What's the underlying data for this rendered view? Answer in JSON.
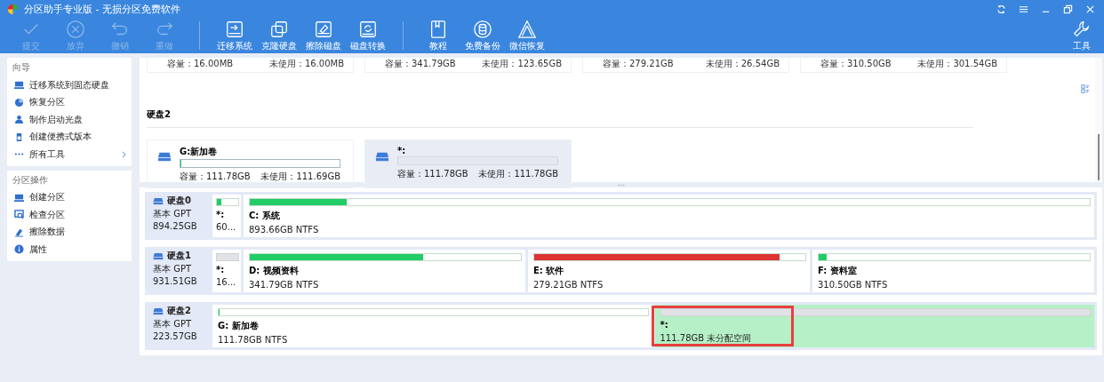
{
  "window": {
    "title": "分区助手专业版 - 无损分区免费软件"
  },
  "toolbar": [
    {
      "label": "提交",
      "disabled": true
    },
    {
      "label": "放弃",
      "disabled": true
    },
    {
      "label": "撤销",
      "disabled": true
    },
    {
      "label": "重做",
      "disabled": true
    },
    {
      "label": "迁移系统",
      "disabled": false
    },
    {
      "label": "克隆硬盘",
      "disabled": false
    },
    {
      "label": "擦除磁盘",
      "disabled": false
    },
    {
      "label": "磁盘转换",
      "disabled": false
    },
    {
      "label": "教程",
      "disabled": false
    },
    {
      "label": "免费备份",
      "disabled": false
    },
    {
      "label": "微信恢复",
      "disabled": false
    }
  ],
  "tools_button": {
    "label": "工具"
  },
  "sidebar": [
    {
      "title": "向导",
      "items": [
        {
          "label": "迁移系统到固态硬盘",
          "more": false
        },
        {
          "label": "恢复分区",
          "more": false
        },
        {
          "label": "制作启动光盘",
          "more": false
        },
        {
          "label": "创建便携式版本",
          "more": false
        },
        {
          "label": "所有工具",
          "more": true
        }
      ]
    },
    {
      "title": "分区操作",
      "items": [
        {
          "label": "创建分区",
          "more": false
        },
        {
          "label": "检查分区",
          "more": false
        },
        {
          "label": "擦除数据",
          "more": false
        },
        {
          "label": "属性",
          "more": false
        }
      ]
    }
  ],
  "cards_above": [
    {
      "capacity": "容量：16.00MB",
      "unused": "未使用：16.00MB"
    },
    {
      "capacity": "容量：341.79GB",
      "unused": "未使用：123.65GB"
    },
    {
      "capacity": "容量：279.21GB",
      "unused": "未使用：26.54GB"
    },
    {
      "capacity": "容量：310.50GB",
      "unused": "未使用：301.54GB"
    }
  ],
  "card_section": {
    "title": "硬盘2",
    "cards": [
      {
        "name": "G:新加卷",
        "kind": "volume",
        "level": 0.001,
        "capacity": "容量：111.78GB",
        "unused": "未使用：111.69GB",
        "selected": false
      },
      {
        "name": "*:",
        "kind": "unallocated",
        "capacity": "容量：111.78GB",
        "unused": "未使用：111.78GB",
        "selected": true
      }
    ]
  },
  "disks": [
    {
      "name": "硬盘0",
      "type": "基本 GPT",
      "size": "894.25GB",
      "partitions": [
        {
          "kind": "small",
          "name": "*:",
          "detail": "60...",
          "level": 0.2,
          "color": "#22cc66",
          "selected": false,
          "highlighted": false
        },
        {
          "kind": "volume",
          "name": "C: 系统",
          "detail": "893.66GB NTFS",
          "level": 0.115,
          "color": "#22cc66",
          "selected": false,
          "highlighted": false
        }
      ]
    },
    {
      "name": "硬盘1",
      "type": "基本 GPT",
      "size": "931.51GB",
      "partitions": [
        {
          "kind": "small-other",
          "name": "*:",
          "detail": "16...",
          "selected": false,
          "highlighted": false
        },
        {
          "kind": "volume",
          "name": "D: 视频资料",
          "detail": "341.79GB NTFS",
          "level": 0.64,
          "color": "#22cc66",
          "selected": false,
          "highlighted": false
        },
        {
          "kind": "volume",
          "name": "E: 软件",
          "detail": "279.21GB NTFS",
          "level": 0.905,
          "color": "#dd3333",
          "selected": false,
          "highlighted": false
        },
        {
          "kind": "volume",
          "name": "F: 资料室",
          "detail": "310.50GB NTFS",
          "level": 0.03,
          "color": "#22cc66",
          "selected": false,
          "highlighted": false
        }
      ]
    },
    {
      "name": "硬盘2",
      "type": "基本 GPT",
      "size": "223.57GB",
      "partitions": [
        {
          "kind": "volume",
          "name": "G: 新加卷",
          "detail": "111.78GB NTFS",
          "level": 0.001,
          "color": "#22cc66",
          "selected": false,
          "highlighted": false
        },
        {
          "kind": "unallocated",
          "name": "*:",
          "detail": "111.78GB 未分配空间",
          "selected": true,
          "highlighted": true
        }
      ]
    }
  ]
}
